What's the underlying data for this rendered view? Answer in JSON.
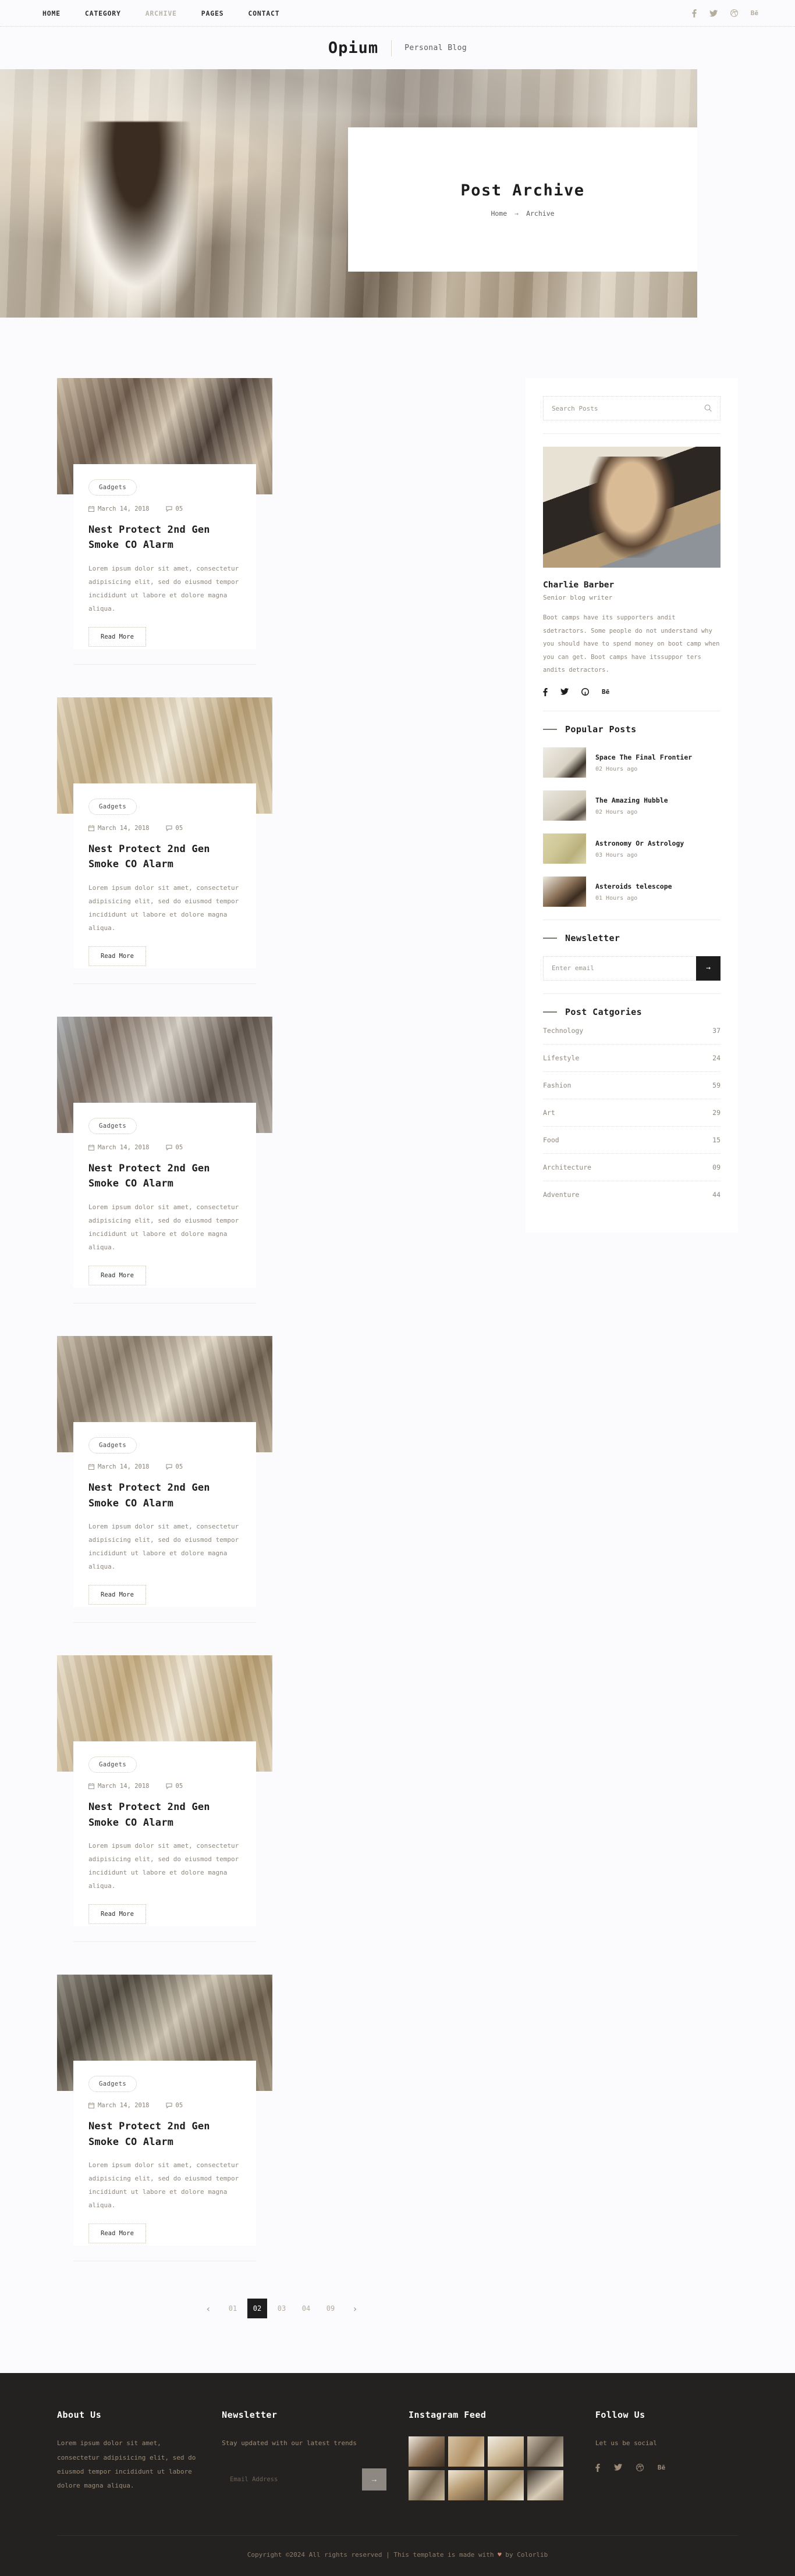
{
  "nav": {
    "items": [
      {
        "label": "HOME",
        "active": true
      },
      {
        "label": "CATEGORY",
        "active": true
      },
      {
        "label": "ARCHIVE",
        "active": false
      },
      {
        "label": "PAGES",
        "active": true
      },
      {
        "label": "CONTACT",
        "active": true
      }
    ],
    "social": [
      "facebook-icon",
      "twitter-icon",
      "dribbble-icon",
      "behance-icon"
    ]
  },
  "brand": {
    "logo": "Opium",
    "tagline": "Personal Blog"
  },
  "hero": {
    "title": "Post Archive",
    "breadcrumb": {
      "home": "Home",
      "arrow": "→",
      "current": "Archive"
    }
  },
  "posts": [
    {
      "category": "Gadgets",
      "date": "March 14, 2018",
      "comments": "05",
      "title": "Nest Protect 2nd Gen Smoke CO Alarm",
      "excerpt": "Lorem ipsum dolor sit amet, consectetur adipisicing elit, sed do eiusmod tempor incididunt ut labore et dolore magna aliqua.",
      "cta": "Read More"
    },
    {
      "category": "Gadgets",
      "date": "March 14, 2018",
      "comments": "05",
      "title": "Nest Protect 2nd Gen Smoke CO Alarm",
      "excerpt": "Lorem ipsum dolor sit amet, consectetur adipisicing elit, sed do eiusmod tempor incididunt ut labore et dolore magna aliqua.",
      "cta": "Read More"
    },
    {
      "category": "Gadgets",
      "date": "March 14, 2018",
      "comments": "05",
      "title": "Nest Protect 2nd Gen Smoke CO Alarm",
      "excerpt": "Lorem ipsum dolor sit amet, consectetur adipisicing elit, sed do eiusmod tempor incididunt ut labore et dolore magna aliqua.",
      "cta": "Read More"
    },
    {
      "category": "Gadgets",
      "date": "March 14, 2018",
      "comments": "05",
      "title": "Nest Protect 2nd Gen Smoke CO Alarm",
      "excerpt": "Lorem ipsum dolor sit amet, consectetur adipisicing elit, sed do eiusmod tempor incididunt ut labore et dolore magna aliqua.",
      "cta": "Read More"
    },
    {
      "category": "Gadgets",
      "date": "March 14, 2018",
      "comments": "05",
      "title": "Nest Protect 2nd Gen Smoke CO Alarm",
      "excerpt": "Lorem ipsum dolor sit amet, consectetur adipisicing elit, sed do eiusmod tempor incididunt ut labore et dolore magna aliqua.",
      "cta": "Read More"
    },
    {
      "category": "Gadgets",
      "date": "March 14, 2018",
      "comments": "05",
      "title": "Nest Protect 2nd Gen Smoke CO Alarm",
      "excerpt": "Lorem ipsum dolor sit amet, consectetur adipisicing elit, sed do eiusmod tempor incididunt ut labore et dolore magna aliqua.",
      "cta": "Read More"
    }
  ],
  "pagination": {
    "prev": "‹",
    "next": "›",
    "pages": [
      "01",
      "02",
      "03",
      "04",
      "09"
    ],
    "active": "02"
  },
  "sidebar": {
    "search": {
      "placeholder": "Search Posts",
      "value": "",
      "icon": "search-icon"
    },
    "author": {
      "name": "Charlie Barber",
      "role": "Senior blog writer",
      "bio": "Boot camps have its supporters andit sdetractors. Some people do not understand why you should have to spend money on boot camp when you can get. Boot camps have itssuppor ters andits detractors.",
      "social": [
        "facebook-icon",
        "twitter-icon",
        "github-icon",
        "behance-icon"
      ]
    },
    "popular": {
      "title": "Popular Posts",
      "items": [
        {
          "title": "Space The Final Frontier",
          "time": "02 Hours ago"
        },
        {
          "title": "The Amazing Hubble",
          "time": "02 Hours ago"
        },
        {
          "title": "Astronomy Or Astrology",
          "time": "03 Hours ago"
        },
        {
          "title": "Asteroids telescope",
          "time": "01 Hours ago"
        }
      ]
    },
    "newsletter": {
      "title": "Newsletter",
      "placeholder": "Enter email",
      "value": "",
      "submit": "→"
    },
    "categories": {
      "title": "Post Catgories",
      "items": [
        {
          "label": "Technology",
          "count": "37"
        },
        {
          "label": "Lifestyle",
          "count": "24"
        },
        {
          "label": "Fashion",
          "count": "59"
        },
        {
          "label": "Art",
          "count": "29"
        },
        {
          "label": "Food",
          "count": "15"
        },
        {
          "label": "Architecture",
          "count": "09"
        },
        {
          "label": "Adventure",
          "count": "44"
        }
      ]
    }
  },
  "footer": {
    "about": {
      "title": "About Us",
      "text": "Lorem ipsum dolor sit amet, consectetur adipisicing elit, sed do eiusmod tempor incididunt ut labore dolore magna aliqua."
    },
    "newsletter": {
      "title": "Newsletter",
      "text": "Stay updated with our latest trends",
      "placeholder": "Email Address",
      "value": "",
      "submit": "→"
    },
    "instagram": {
      "title": "Instagram Feed"
    },
    "follow": {
      "title": "Follow Us",
      "text": "Let us be social",
      "social": [
        "facebook-icon",
        "twitter-icon",
        "dribbble-icon",
        "behance-icon"
      ]
    },
    "copyright_a": "Copyright ©2024 All rights reserved | This template is made with ",
    "copyright_heart": "♥",
    "copyright_b": " by Colorlib"
  }
}
